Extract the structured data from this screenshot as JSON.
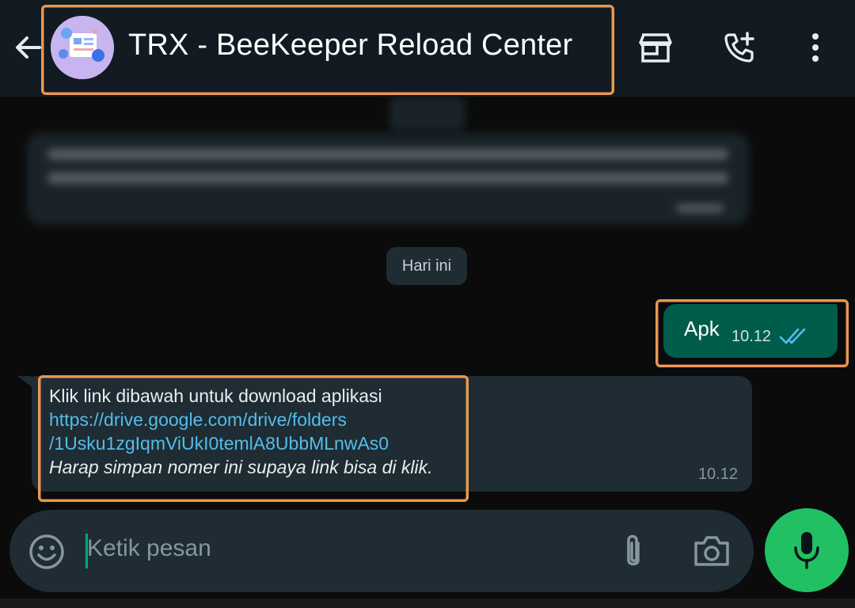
{
  "header": {
    "title": "TRX - BeeKeeper Reload Center",
    "icons": [
      "back-arrow-icon",
      "store-icon",
      "add-call-icon",
      "more-vert-icon"
    ]
  },
  "chat": {
    "date_divider": "Hari ini",
    "outgoing": {
      "text": "Apk",
      "time": "10.12",
      "status": "read"
    },
    "incoming": {
      "line1": "Klik link dibawah untuk download aplikasi",
      "link_line1": "https://drive.google.com/drive/folders",
      "link_line2": "/1Usku1zgIqmViUkI0temlA8UbbMLnwAs0",
      "note": "Harap simpan nomer ini supaya link bisa di klik.",
      "time": "10.12"
    }
  },
  "composer": {
    "placeholder": "Ketik pesan",
    "icons": [
      "emoji-icon",
      "attach-icon",
      "camera-icon",
      "mic-icon"
    ]
  },
  "colors": {
    "header_bg": "#111b21",
    "outgoing_bubble": "#005c4b",
    "incoming_bubble": "#1f2c33",
    "link": "#53bdeb",
    "mic_button": "#21c063",
    "highlight": "#e89a4a"
  }
}
